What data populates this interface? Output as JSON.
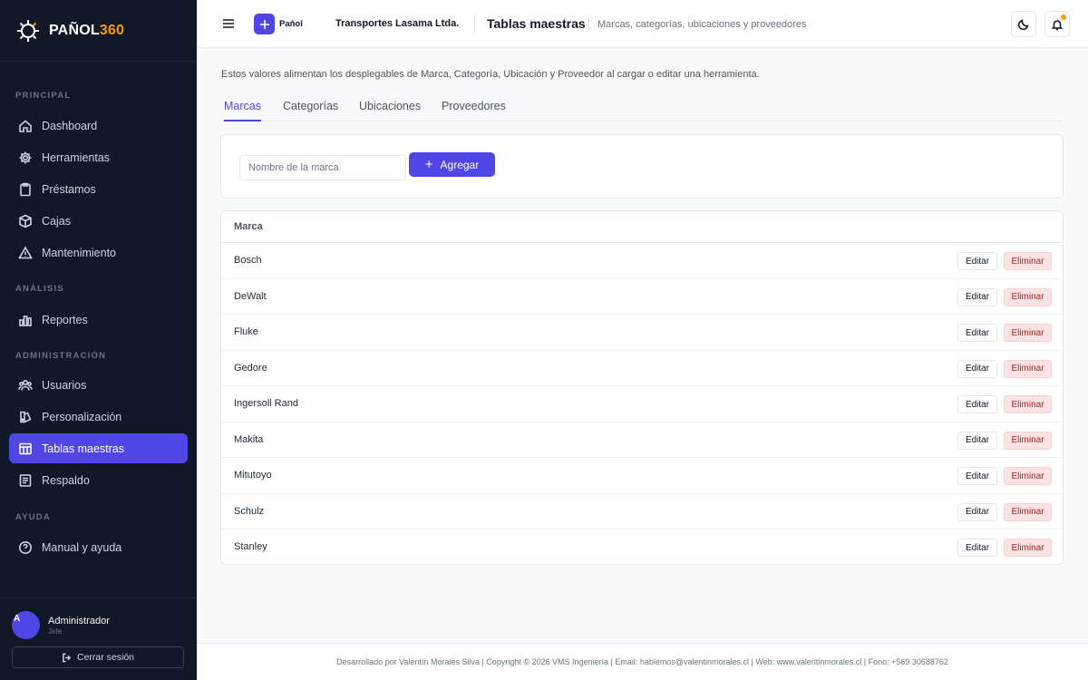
{
  "app": {
    "brand_main": "PAÑOL",
    "brand_accent": "360",
    "accent_color": "#4f46e5",
    "brand_accent_color": "#f59e0b"
  },
  "sidebar": {
    "sections": [
      {
        "title": "PRINCIPAL"
      },
      {
        "title": "ANÁLISIS"
      },
      {
        "title": "ADMINISTRACIÓN"
      },
      {
        "title": "AYUDA"
      }
    ],
    "items": [
      {
        "label": "Dashboard",
        "icon": "home-icon"
      },
      {
        "label": "Herramientas",
        "icon": "gear-icon"
      },
      {
        "label": "Préstamos",
        "icon": "clipboard-icon"
      },
      {
        "label": "Cajas",
        "icon": "box-icon"
      },
      {
        "label": "Mantenimiento",
        "icon": "warning-icon"
      },
      {
        "label": "Reportes",
        "icon": "bar-chart-icon"
      },
      {
        "label": "Usuarios",
        "icon": "users-icon"
      },
      {
        "label": "Personalización",
        "icon": "palette-icon"
      },
      {
        "label": "Tablas maestras",
        "icon": "table-icon",
        "active": true
      },
      {
        "label": "Respaldo",
        "icon": "archive-icon"
      },
      {
        "label": "Manual y ayuda",
        "icon": "help-circle-icon"
      }
    ],
    "user": {
      "avatar_initial": "A",
      "name": "Administrador",
      "role": "Jefe",
      "logout_label": "Cerrar sesión"
    }
  },
  "topbar": {
    "quick_label": "Pañol",
    "company": "Transportes Lasama Ltda.",
    "title": "Tablas maestras",
    "subtitle": "Marcas, categorías, ubicaciones y proveedores"
  },
  "main": {
    "intro": "Estos valores alimentan los desplegables de Marca, Categoría, Ubicación y Proveedor al cargar o editar una herramienta.",
    "tabs": [
      {
        "label": "Marcas",
        "active": true
      },
      {
        "label": "Categorías"
      },
      {
        "label": "Ubicaciones"
      },
      {
        "label": "Proveedores"
      }
    ],
    "add_form": {
      "placeholder": "Nombre de la marca",
      "value": "",
      "button_label": "Agregar"
    },
    "table": {
      "header": "Marca",
      "edit_label": "Editar",
      "delete_label": "Eliminar",
      "rows": [
        "Bosch",
        "DeWalt",
        "Fluke",
        "Gedore",
        "Ingersoll Rand",
        "Makita",
        "Mitutoyo",
        "Schulz",
        "Stanley"
      ]
    }
  },
  "footer": {
    "text": "Desarrollado por Valentín Morales Silva  |  Copyright © 2026 VMS Ingeniería  |  Email: hablemos@valentinmorales.cl  |  Web: www.valentinmorales.cl  |  Fono: +569 30688762"
  }
}
